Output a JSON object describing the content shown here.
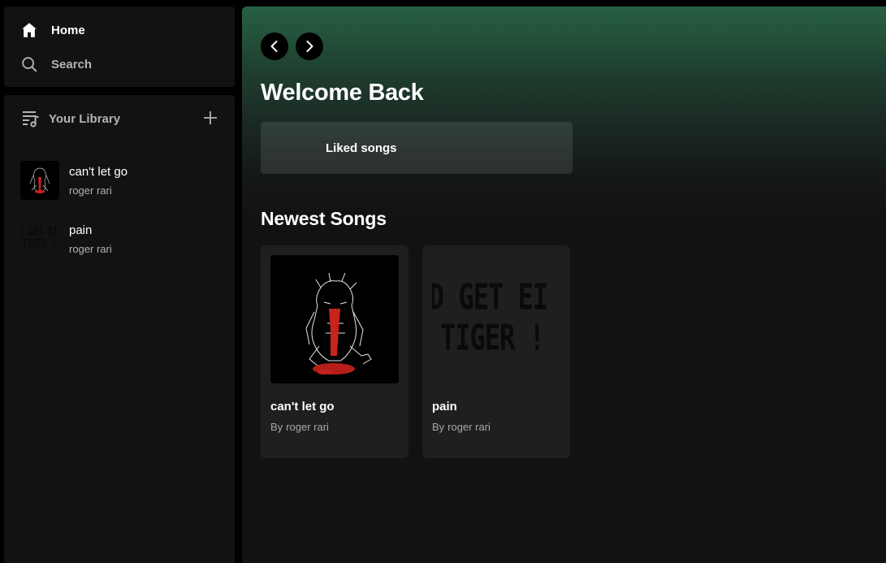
{
  "sidebar": {
    "nav": [
      {
        "label": "Home",
        "icon": "home-icon"
      },
      {
        "label": "Search",
        "icon": "search-icon"
      }
    ],
    "library": {
      "title": "Your Library",
      "items": [
        {
          "title": "can't let go",
          "artist": "roger rari",
          "art": "red-drip-character-art"
        },
        {
          "title": "pain",
          "artist": "roger rari",
          "art": "tiger-text-art"
        }
      ]
    }
  },
  "main": {
    "greeting": "Welcome Back",
    "liked": {
      "label": "Liked songs"
    },
    "newest": {
      "title": "Newest Songs",
      "by_prefix": "By",
      "songs": [
        {
          "title": "can't let go",
          "artist": "roger rari"
        },
        {
          "title": "pain",
          "artist": "roger rari"
        }
      ]
    }
  },
  "art_text": {
    "line1": "D GET EI",
    "line2": "TIGER !"
  },
  "colors": {
    "background": "#000000",
    "panel": "#121212",
    "card": "#1f1f1f",
    "gradient_top": "#276042",
    "text_primary": "#ffffff",
    "text_secondary": "#b3b3b3",
    "art_red": "#c8241e"
  }
}
